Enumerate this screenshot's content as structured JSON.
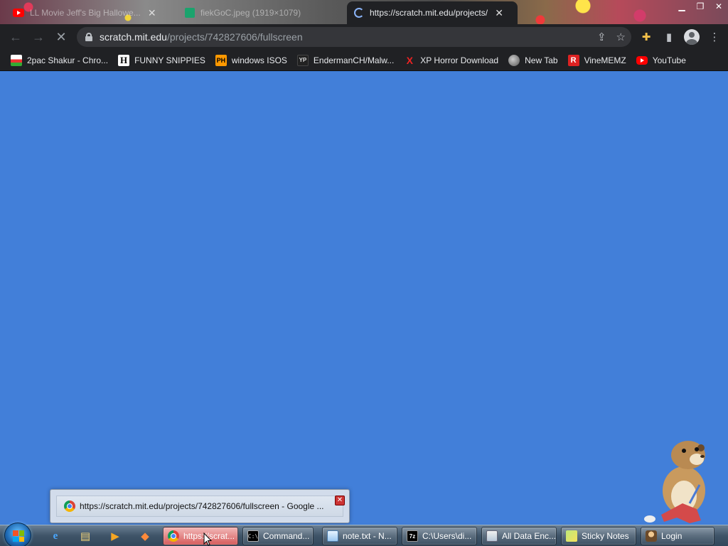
{
  "browser": {
    "tabs": [
      {
        "title": "LL Movie Jeff's Big Hallowe...",
        "close": "✕",
        "icon": "youtube-icon"
      },
      {
        "title": "fiekGoC.jpeg (1919×1079)",
        "close": "",
        "icon": "image-icon"
      },
      {
        "title": "https://scratch.mit.edu/projects/",
        "close": "✕",
        "icon": "loading-spinner-icon"
      }
    ],
    "window_controls": {
      "minimize": "▁",
      "maximize": "❐",
      "close": "✕"
    },
    "toolbar": {
      "back": "←",
      "forward": "→",
      "reload": "✕",
      "url_host": "scratch.mit.edu",
      "url_path": "/projects/742827606/fullscreen",
      "share": "⇪",
      "star": "☆",
      "extensions": "✚",
      "sidepanel": "▮",
      "menu": "⋮"
    },
    "bookmarks": [
      {
        "label": "2pac Shakur - Chro...",
        "icon": "paint-icon",
        "glyph": ""
      },
      {
        "label": "FUNNY SNIPPIES",
        "icon": "h-icon",
        "glyph": "H"
      },
      {
        "label": "windows ISOS",
        "icon": "ph-icon",
        "glyph": "PH"
      },
      {
        "label": "EndermanCH/Malw...",
        "icon": "yp-icon",
        "glyph": "YP"
      },
      {
        "label": "XP Horror Download",
        "icon": "x-icon",
        "glyph": "X"
      },
      {
        "label": "New Tab",
        "icon": "globe-icon",
        "glyph": ""
      },
      {
        "label": "VineMEMZ",
        "icon": "r-icon",
        "glyph": "R"
      },
      {
        "label": "YouTube",
        "icon": "youtube-icon",
        "glyph": ""
      }
    ]
  },
  "thumbnail": {
    "title": "https://scratch.mit.edu/projects/742827606/fullscreen - Google ...",
    "close": "✕"
  },
  "taskbar": {
    "quick_launch": [
      {
        "icon": "internet-explorer-icon",
        "glyph": "e"
      },
      {
        "icon": "file-explorer-icon",
        "glyph": "▤"
      },
      {
        "icon": "media-player-icon",
        "glyph": "▶"
      },
      {
        "icon": "app-icon",
        "glyph": "◆"
      }
    ],
    "tasks": [
      {
        "label": "https://scrat...",
        "icon": "chrome-icon"
      },
      {
        "label": "Command...",
        "icon": "cmd-icon",
        "glyph": "C:\\"
      },
      {
        "label": "note.txt - N...",
        "icon": "notepad-icon"
      },
      {
        "label": "C:\\Users\\di...",
        "icon": "7zip-icon",
        "glyph": "7z"
      },
      {
        "label": "All Data Enc...",
        "icon": "data-icon"
      },
      {
        "label": "Sticky Notes",
        "icon": "sticky-notes-icon"
      },
      {
        "label": "Login",
        "icon": "login-icon"
      }
    ]
  },
  "colors": {
    "content_bg": "#427fd9",
    "chrome_dark": "#202124",
    "omnibox": "#35363a"
  }
}
